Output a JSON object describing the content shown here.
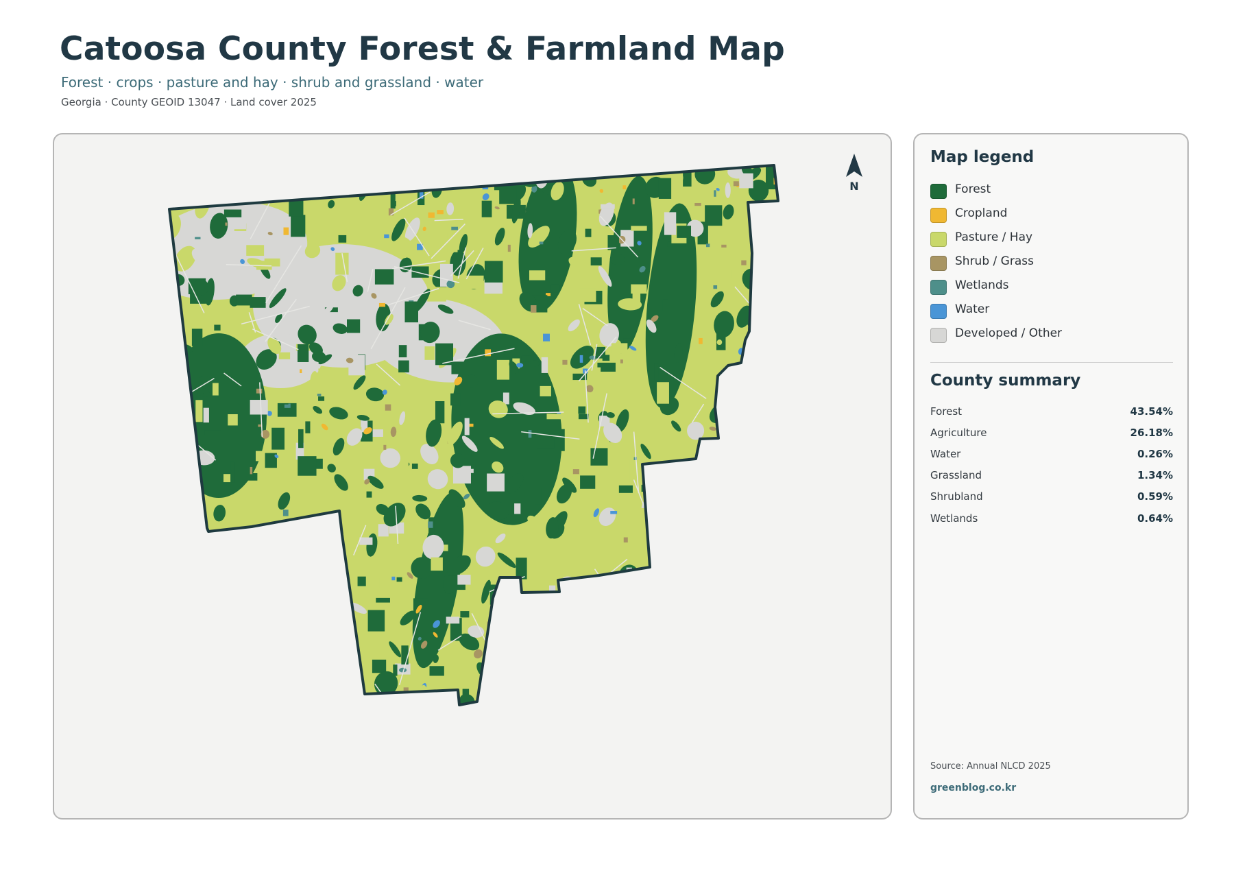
{
  "header": {
    "title": "Catoosa County Forest & Farmland Map",
    "subtitle": "Forest · crops · pasture and hay · shrub and grassland · water",
    "meta": "Georgia · County GEOID 13047 · Land cover 2025"
  },
  "map": {
    "north_label": "N",
    "icon": "north-arrow-icon"
  },
  "legend": {
    "title": "Map legend",
    "items": [
      {
        "label": "Forest",
        "color": "#1f6b3a"
      },
      {
        "label": "Cropland",
        "color": "#f0b832"
      },
      {
        "label": "Pasture / Hay",
        "color": "#c9d86a"
      },
      {
        "label": "Shrub / Grass",
        "color": "#a89563"
      },
      {
        "label": "Wetlands",
        "color": "#4e8f8a"
      },
      {
        "label": "Water",
        "color": "#4a95d6"
      },
      {
        "label": "Developed / Other",
        "color": "#d7d7d5"
      }
    ]
  },
  "summary": {
    "title": "County summary",
    "rows": [
      {
        "label": "Forest",
        "value": "43.54%"
      },
      {
        "label": "Agriculture",
        "value": "26.18%"
      },
      {
        "label": "Water",
        "value": "0.26%"
      },
      {
        "label": "Grassland",
        "value": "1.34%"
      },
      {
        "label": "Shrubland",
        "value": "0.59%"
      },
      {
        "label": "Wetlands",
        "value": "0.64%"
      }
    ]
  },
  "footer": {
    "source": "Source: Annual NLCD 2025",
    "site": "greenblog.co.kr"
  }
}
